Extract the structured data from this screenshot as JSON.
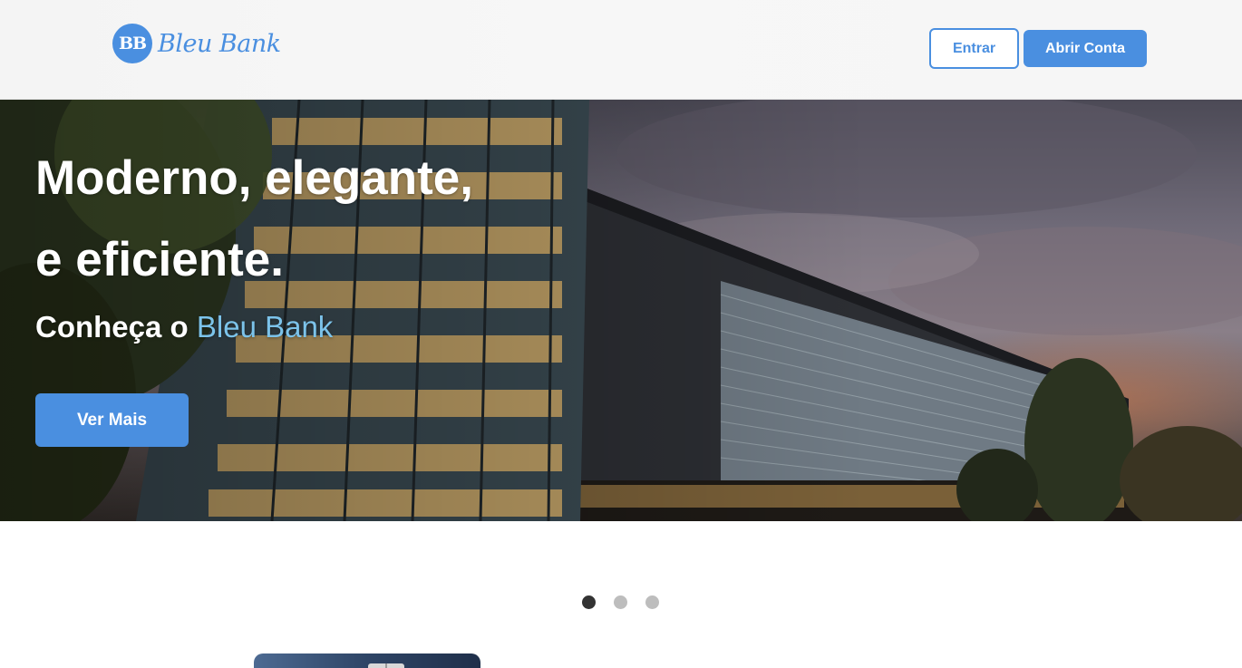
{
  "header": {
    "logo_badge": "BB",
    "logo_text": "Bleu Bank",
    "login_label": "Entrar",
    "signup_label": "Abrir Conta"
  },
  "hero": {
    "title_line1": "Moderno, elegante,",
    "title_line2": "e eficiente.",
    "subtitle_prefix": "Conheça o",
    "subtitle_brand": "Bleu Bank",
    "cta_label": "Ver Mais"
  },
  "carousel": {
    "slide_count": 3,
    "active_index": 0
  },
  "colors": {
    "accent": "#4a8fe0",
    "brand_highlight": "#7cc3ea",
    "dot_active": "#333333",
    "dot_inactive": "#bdbdbd"
  },
  "icons": {
    "logo": "bb-circle-logo",
    "card": "credit-card-chip"
  }
}
